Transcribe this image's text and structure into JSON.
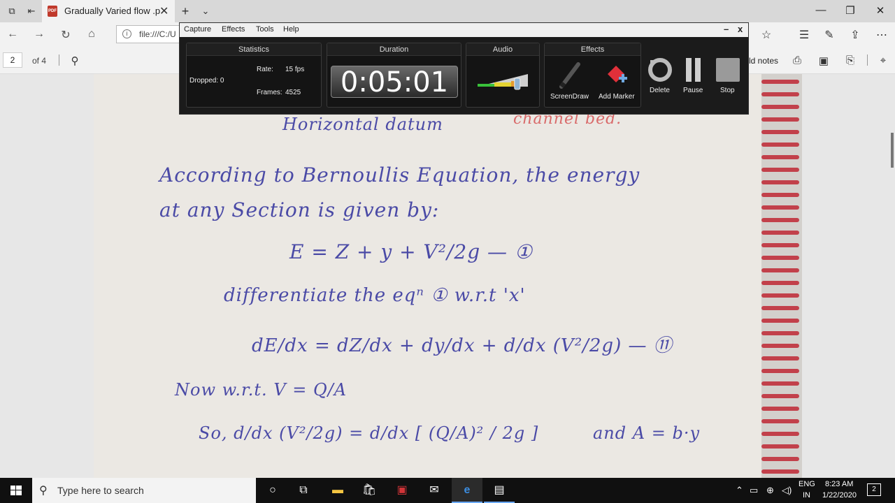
{
  "browser": {
    "tab_title": "Gradually Varied flow .p",
    "address": "file:///C:/U",
    "pdf_badge": "PDF"
  },
  "pdf_toolbar": {
    "page_number": "2",
    "page_count": "of 4",
    "notes_label": "ld notes"
  },
  "recorder": {
    "menu": [
      "Capture",
      "Effects",
      "Tools",
      "Help"
    ],
    "minimize": "–",
    "close": "x",
    "statistics": {
      "title": "Statistics",
      "dropped": "Dropped:  0",
      "rate_label": "Rate:",
      "rate_value": "15 fps",
      "frames_label": "Frames:",
      "frames_value": "4525"
    },
    "duration": {
      "title": "Duration",
      "time": "0:05:01"
    },
    "audio": {
      "title": "Audio",
      "level": 0.8
    },
    "effects": {
      "title": "Effects",
      "screendraw": "ScreenDraw",
      "add_marker": "Add Marker"
    },
    "buttons": {
      "delete": "Delete",
      "pause": "Pause",
      "stop": "Stop"
    }
  },
  "document": {
    "lines": [
      "Horizontal datum",
      "channel bed.",
      "According to Bernoullis Equation, the energy",
      "at any Section is given by:",
      "E = Z + y + V²/2g  — ①",
      "differentiate the eqⁿ ① w.r.t 'x'",
      "dE/dx = dZ/dx + dy/dx + d/dx (V²/2g)  — ⑪",
      "Now   w.r.t.   V = Q/A",
      "So,  d/dx (V²/2g) = d/dx [ (Q/A)² / 2g ]",
      "and A = b·y"
    ]
  },
  "taskbar": {
    "search_placeholder": "Type here to search",
    "lang_top": "ENG",
    "lang_bottom": "IN",
    "time": "8:23 AM",
    "date": "1/22/2020",
    "notif_count": "2"
  }
}
